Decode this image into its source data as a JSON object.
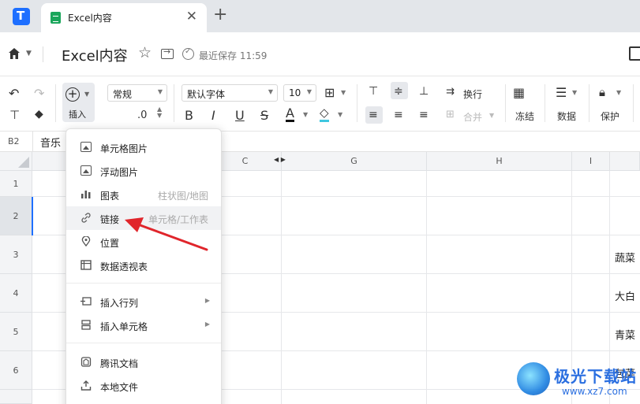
{
  "tabs": {
    "doc_tab_title": "Excel内容",
    "close_glyph": "✕",
    "new_tab_glyph": "+"
  },
  "title_bar": {
    "doc_title": "Excel内容",
    "save_status": "最近保存 11:59"
  },
  "toolbar": {
    "insert_label": "插入",
    "number_format": "常规",
    "decimal": ".0",
    "font_family": "默认字体",
    "font_size": "10",
    "bold": "B",
    "italic": "I",
    "underline": "U",
    "strike": "S",
    "font_color": "A",
    "wrap_label": "换行",
    "merge_label": "合并",
    "freeze_label": "冻结",
    "data_label": "数据",
    "protect_label": "保护"
  },
  "formula_bar": {
    "cell_ref": "B2",
    "value": "音乐"
  },
  "grid": {
    "columns": [
      "C",
      "G",
      "H",
      "I"
    ],
    "rows": [
      "1",
      "2",
      "3",
      "4",
      "5",
      "6"
    ],
    "cells": {
      "r3": "蔬菜",
      "r4": "大白",
      "r5": "青菜",
      "r6": "包菜"
    }
  },
  "insert_menu": {
    "items": [
      {
        "label": "单元格图片",
        "hint": ""
      },
      {
        "label": "浮动图片",
        "hint": ""
      },
      {
        "label": "图表",
        "hint": "柱状图/地图"
      },
      {
        "label": "链接",
        "hint": "单元格/工作表"
      },
      {
        "label": "位置",
        "hint": ""
      },
      {
        "label": "数据透视表",
        "hint": ""
      },
      {
        "label": "插入行列",
        "hint": ""
      },
      {
        "label": "插入单元格",
        "hint": ""
      },
      {
        "label": "腾讯文档",
        "hint": ""
      },
      {
        "label": "本地文件",
        "hint": ""
      }
    ]
  },
  "watermark": {
    "brand": "极光下载站",
    "url": "www.xz7.com"
  },
  "colors": {
    "accent": "#1e6fff",
    "sheet_green": "#1aa65b",
    "annotation_red": "#e0252b"
  }
}
